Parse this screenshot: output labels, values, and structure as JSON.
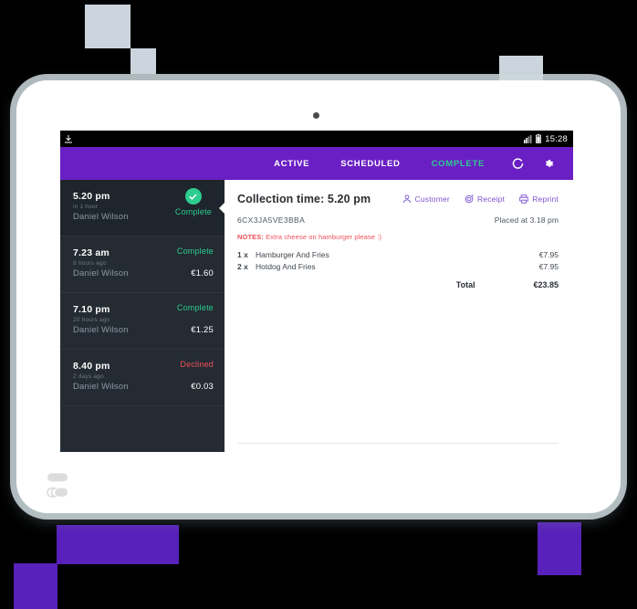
{
  "device": {
    "brand_logo_icon": "clover-logo-icon",
    "camera_icon": "camera-dot-icon"
  },
  "status_bar": {
    "download_icon": "download-icon",
    "signal_icon": "signal-icon",
    "battery_icon": "battery-icon",
    "clock": "15:28"
  },
  "app_bar": {
    "tabs": [
      {
        "label": "ACTIVE",
        "active": false
      },
      {
        "label": "SCHEDULED",
        "active": false
      },
      {
        "label": "COMPLETE",
        "active": true
      }
    ],
    "refresh_icon": "refresh-icon",
    "settings_icon": "gear-icon",
    "background_color": "#6a1fc4",
    "active_tab_color": "#2ecc8f"
  },
  "order_list": [
    {
      "time": "5.20 pm",
      "relative": "in 1 hour",
      "customer": "Daniel Wilson",
      "status": "Complete",
      "status_type": "complete",
      "amount": "",
      "selected": true,
      "badge_icon": "check-circle-icon"
    },
    {
      "time": "7.23 am",
      "relative": "8 hours ago",
      "customer": "Daniel Wilson",
      "status": "Complete",
      "status_type": "complete",
      "amount": "€1.60",
      "selected": false,
      "badge_icon": ""
    },
    {
      "time": "7.10 pm",
      "relative": "20 hours ago",
      "customer": "Daniel Wilson",
      "status": "Complete",
      "status_type": "complete",
      "amount": "€1.25",
      "selected": false,
      "badge_icon": ""
    },
    {
      "time": "8.40 pm",
      "relative": "2 days ago",
      "customer": "Daniel Wilson",
      "status": "Declined",
      "status_type": "declined",
      "amount": "€0.03",
      "selected": false,
      "badge_icon": ""
    }
  ],
  "order_detail": {
    "title": "Collection time: 5.20 pm",
    "actions": [
      {
        "label": "Customer",
        "icon": "person-icon"
      },
      {
        "label": "Receipt",
        "icon": "receipt-icon"
      },
      {
        "label": "Reprint",
        "icon": "printer-icon"
      }
    ],
    "order_code": "6CX3JA5VE3BBA",
    "placed_at": "Placed at 3.18 pm",
    "notes_label": "NOTES:",
    "notes_text": "Extra cheese on hamburger please :)",
    "items": [
      {
        "qty": "1 x",
        "name": "Hamburger And Fries",
        "price": "€7.95"
      },
      {
        "qty": "2 x",
        "name": "Hotdog And Fries",
        "price": "€7.95"
      }
    ],
    "total_label": "Total",
    "total_value": "€23.85",
    "notes_color": "#f0505a",
    "action_color": "#7b52cf"
  },
  "nav_bar": {
    "back_icon": "back-arrow-icon",
    "home_icon": "home-icon",
    "recents_icon": "recents-icon"
  },
  "decorations": {
    "gray_color": "#ccd5dd",
    "purple_color": "#5821bb"
  }
}
